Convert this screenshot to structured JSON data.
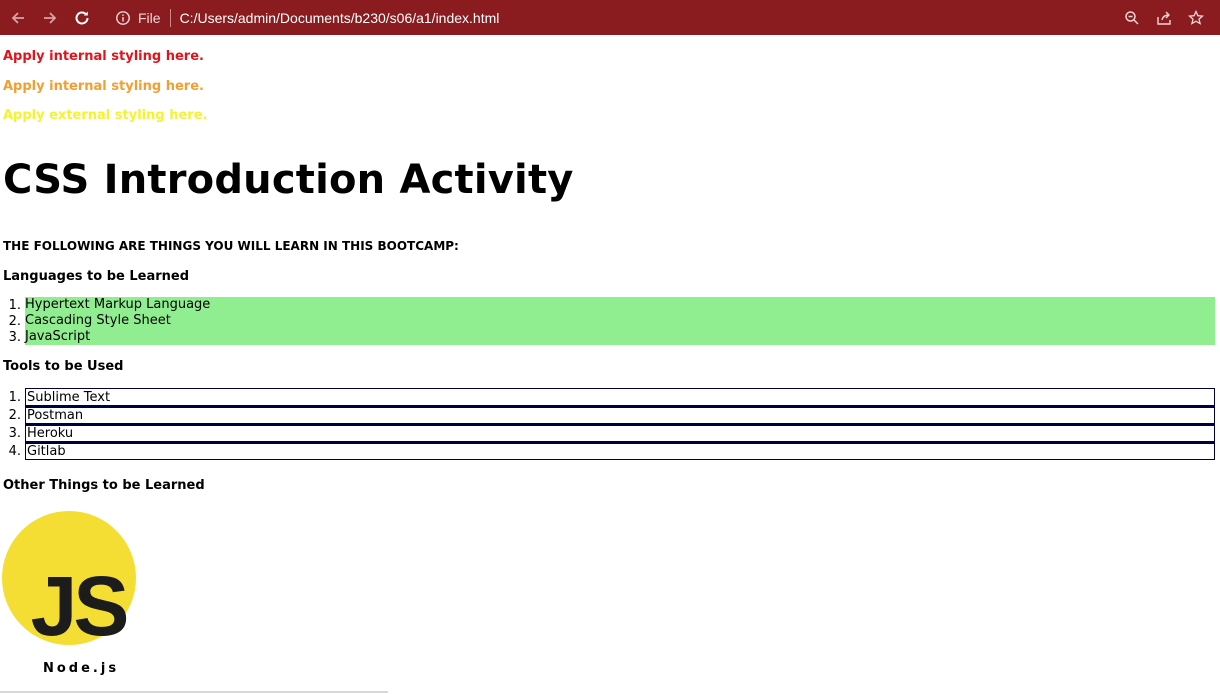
{
  "browser": {
    "url_scheme_label": "File",
    "url": "C:/Users/admin/Documents/b230/s06/a1/index.html",
    "icons": [
      "back-icon",
      "forward-icon",
      "reload-icon",
      "info-icon",
      "zoom-icon",
      "share-icon",
      "star-icon"
    ]
  },
  "page": {
    "paragraphs": [
      {
        "text": "Apply internal styling here.",
        "color": "#e0141c"
      },
      {
        "text": "Apply internal styling here.",
        "color": "#f0a030"
      },
      {
        "text": "Apply external styling here.",
        "color": "#f4f42a"
      }
    ],
    "title": "CSS Introduction Activity",
    "subtitle": "THE FOLLOWING ARE THINGS YOU WILL LEARN IN THIS BOOTCAMP:",
    "languages": {
      "heading": "Languages to be Learned",
      "highlight_color": "#90ee90",
      "items": [
        {
          "num": "1.",
          "label": "Hypertext Markup Language"
        },
        {
          "num": "2.",
          "label": "Cascading Style Sheet"
        },
        {
          "num": "3.",
          "label": "JavaScript"
        }
      ]
    },
    "tools": {
      "heading": "Tools to be Used",
      "items": [
        {
          "num": "1.",
          "label": "Sublime Text"
        },
        {
          "num": "2.",
          "label": "Postman"
        },
        {
          "num": "3.",
          "label": "Heroku"
        },
        {
          "num": "4.",
          "label": "Gitlab"
        }
      ]
    },
    "other": {
      "heading": "Other Things to be Learned",
      "logo_text": "JS",
      "logo_color": "#f5de33",
      "caption": "Node.js"
    }
  }
}
